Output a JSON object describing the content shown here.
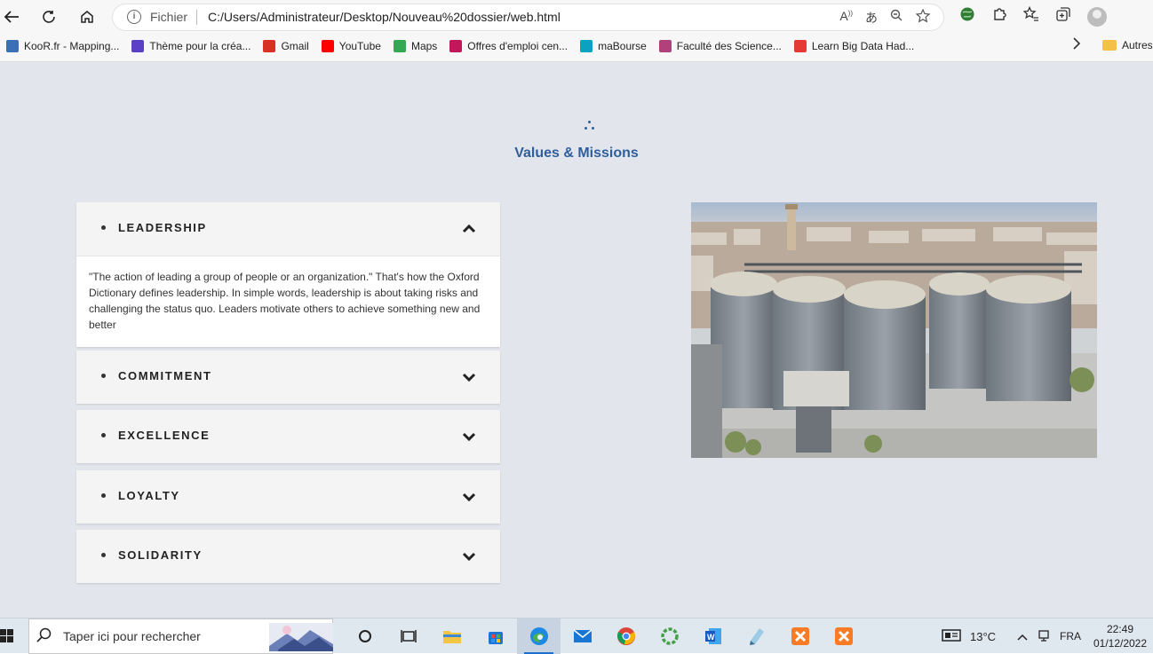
{
  "browser": {
    "scheme_label": "Fichier",
    "url": "C:/Users/Administrateur/Desktop/Nouveau%20dossier/web.html",
    "bookmarks": [
      {
        "label": "KooR.fr - Mapping...",
        "color": "#3b6fb6"
      },
      {
        "label": "Thème pour la créa...",
        "color": "#5b3fc4"
      },
      {
        "label": "Gmail",
        "color": "#d93025"
      },
      {
        "label": "YouTube",
        "color": "#ff0000"
      },
      {
        "label": "Maps",
        "color": "#34a853"
      },
      {
        "label": "Offres d'emploi cen...",
        "color": "#c2185b"
      },
      {
        "label": "maBourse",
        "color": "#0aa2c0"
      },
      {
        "label": "Faculté des Science...",
        "color": "#b0417a"
      },
      {
        "label": "Learn Big Data Had...",
        "color": "#e53935"
      }
    ],
    "other_bookmarks": "Autres"
  },
  "page": {
    "section_title": "Values & Missions",
    "accordion": [
      {
        "label": "LEADERSHIP",
        "expanded": true,
        "body": "\"The action of leading a group of people or an organization.\" That's how the Oxford Dictionary defines leadership. In simple words, leadership is about taking risks and challenging the status quo. Leaders motivate others to achieve something new and better"
      },
      {
        "label": "COMMITMENT",
        "expanded": false
      },
      {
        "label": "EXCELLENCE",
        "expanded": false
      },
      {
        "label": "LOYALTY",
        "expanded": false
      },
      {
        "label": "SOLIDARITY",
        "expanded": false
      }
    ],
    "accent": "#2f5e9e"
  },
  "taskbar": {
    "search_placeholder": "Taper ici pour rechercher",
    "weather": "13°C",
    "language": "FRA",
    "time": "22:49",
    "date": "01/12/2022",
    "apps": [
      "task-view",
      "file-explorer",
      "store",
      "edge",
      "mail",
      "chrome",
      "app-green",
      "word",
      "notes",
      "xampp",
      "xampp-2"
    ]
  }
}
